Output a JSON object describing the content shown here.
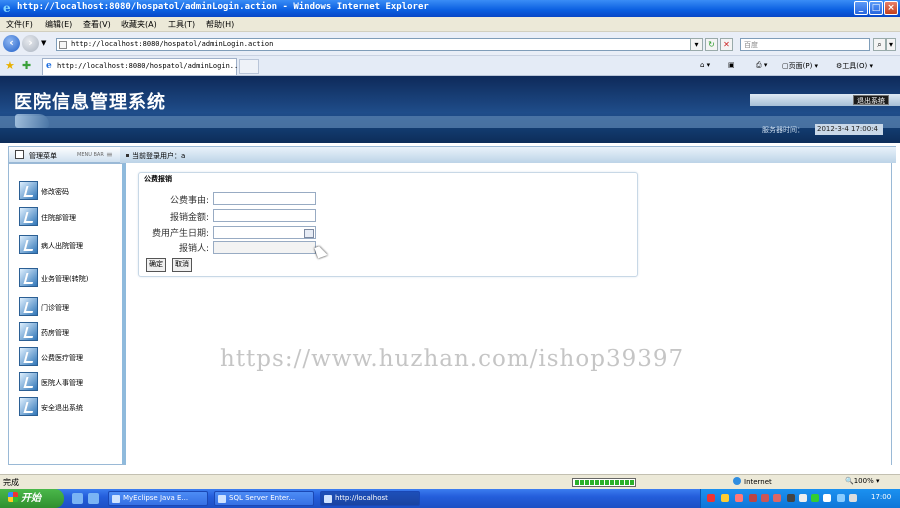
{
  "browser": {
    "window_title": "http://localhost:8080/hospatol/adminLogin.action - Windows Internet Explorer",
    "menu": [
      "文件(F)",
      "编辑(E)",
      "查看(V)",
      "收藏夹(A)",
      "工具(T)",
      "帮助(H)"
    ],
    "address_url": "http://localhost:8080/hospatol/adminLogin.action",
    "search_placeholder": "百度",
    "tab_label": "http://localhost:8080/hospatol/adminLogin...",
    "commands": {
      "page": "页面(P)",
      "tools": "工具(O)"
    },
    "status_text": "完成",
    "zone": "Internet",
    "zoom": "100%"
  },
  "app": {
    "title": "医院信息管理系统",
    "logout_label": "退出系统",
    "server_time_label": "服务器时间：",
    "server_time": "2012-3-4 17:00:4"
  },
  "sidebar": {
    "header": "管理菜单",
    "header_small": "MENU BAR",
    "items": [
      {
        "label": "修改密码"
      },
      {
        "label": "住院部管理"
      },
      {
        "label": "病人出院管理"
      },
      {
        "label": "业务管理(转院)"
      },
      {
        "label": "门诊管理"
      },
      {
        "label": "药房管理"
      },
      {
        "label": "公费医疗管理"
      },
      {
        "label": "医院人事管理"
      },
      {
        "label": "安全退出系统"
      }
    ]
  },
  "main": {
    "current_user_label": "当前登录用户：",
    "current_user": "a",
    "panel_title": "公费报销",
    "fields": [
      {
        "label": "公费事由:",
        "value": ""
      },
      {
        "label": "报销金额:",
        "value": ""
      },
      {
        "label": "费用产生日期:",
        "value": ""
      },
      {
        "label": "报销人:",
        "value": ""
      }
    ],
    "ok_button": "确定",
    "cancel_button": "取消"
  },
  "watermark": "https://www.huzhan.com/ishop39397",
  "taskbar": {
    "start_label": "开始",
    "items": [
      "MyEclipse Java E...",
      "SQL Server Enter...",
      "http://localhost"
    ],
    "clock": "17:00"
  }
}
